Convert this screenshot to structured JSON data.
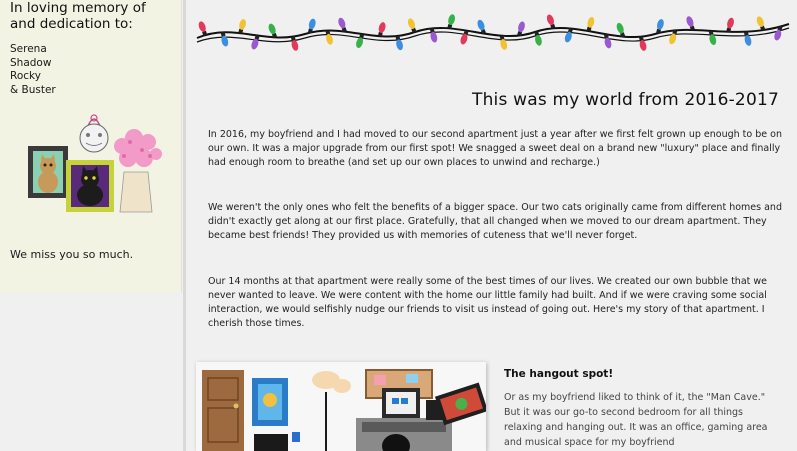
{
  "sidebar": {
    "heading_line1": "In loving memory of",
    "heading_line2": "and dedication to:",
    "names": [
      "Serena",
      "Shadow",
      "Rocky",
      "& Buster"
    ],
    "footer": "We miss you so much."
  },
  "main": {
    "title": "This was my world from 2016-2017",
    "paragraphs": [
      "In 2016, my boyfriend and I had moved to our second apartment just a year after we first felt grown up enough to be on our own. It was a major upgrade from our first spot! We snagged a sweet deal on a brand new \"luxury\" place and finally had enough room to breathe (and set up our own places to unwind and recharge.)",
      "We weren't the only ones who felt the benefits of a bigger space. Our two cats originally came from different homes and didn't exactly get along at our first place. Gratefully, that all changed when we moved to our dream apartment. They became best friends! They provided us with memories of cuteness that we'll never forget.",
      "Our 14 months at that apartment were really some of the best times of our lives. We created our own bubble that we never wanted to leave. We were content with the home our little family had built. And if we were craving some social interaction, we would selfishly nudge our friends to visit us instead of going out. Here's my story of that apartment. I cherish those times."
    ],
    "section": {
      "title": "The hangout spot!",
      "body": "Or as my boyfriend liked to think of it, the \"Man Cave.\" But it was our go-to second bedroom for all things relaxing and hanging out. It was an office, gaming area and musical space for my boyfriend"
    }
  },
  "colors": {
    "sidebar_bg": "#f3f3e4",
    "page_bg": "#f0f0f0",
    "bulbs": [
      "#e23b5a",
      "#f1c232",
      "#36b24a",
      "#3c8ee0",
      "#9b59d0"
    ]
  },
  "icons": [
    "string-lights-icon",
    "memorial-cats-illustration",
    "room-illustration"
  ]
}
